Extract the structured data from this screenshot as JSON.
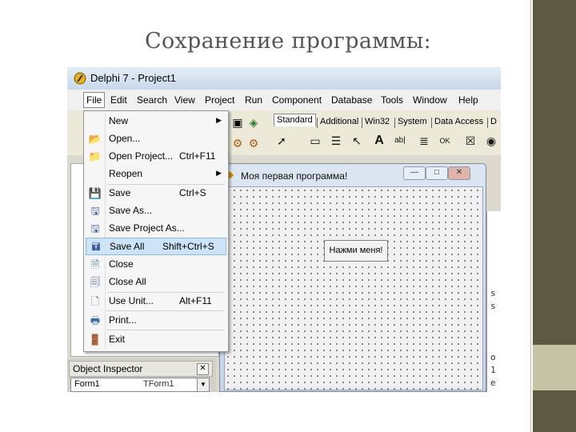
{
  "slide": {
    "title": "Сохранение программы:"
  },
  "colors": {
    "sidebar": "#5c5842",
    "sidebar_accent": "#c5c3a3",
    "menu_highlight": "#cde3f7"
  },
  "ide": {
    "title": "Delphi 7 - Project1",
    "menu": [
      "File",
      "Edit",
      "Search",
      "View",
      "Project",
      "Run",
      "Component",
      "Database",
      "Tools",
      "Window",
      "Help"
    ],
    "palette_tabs": [
      "Standard",
      "Additional",
      "Win32",
      "System",
      "Data Access",
      "D"
    ],
    "palette_icons": [
      "pointer-icon",
      "frame-icon",
      "main-menu-icon",
      "popup-menu-icon",
      "label-icon",
      "edit-icon",
      "memo-icon",
      "button-icon",
      "checkbox-icon",
      "radiobutton-icon"
    ],
    "side_fragments": [
      "s",
      "s",
      "o",
      "1",
      "e"
    ]
  },
  "file_menu": {
    "items": [
      {
        "label": "New",
        "shortcut": "",
        "submenu": true,
        "icon": ""
      },
      {
        "label": "Open...",
        "shortcut": "",
        "submenu": false,
        "icon": "open-folder-icon"
      },
      {
        "label": "Open Project...",
        "shortcut": "Ctrl+F11",
        "submenu": false,
        "icon": "open-project-icon"
      },
      {
        "label": "Reopen",
        "shortcut": "",
        "submenu": true,
        "icon": ""
      },
      {
        "label": "Save",
        "shortcut": "Ctrl+S",
        "submenu": false,
        "icon": "save-icon"
      },
      {
        "label": "Save As...",
        "shortcut": "",
        "submenu": false,
        "icon": "save-as-icon"
      },
      {
        "label": "Save Project As...",
        "shortcut": "",
        "submenu": false,
        "icon": "save-project-icon"
      },
      {
        "label": "Save All",
        "shortcut": "Shift+Ctrl+S",
        "submenu": false,
        "icon": "save-all-icon",
        "highlighted": true
      },
      {
        "label": "Close",
        "shortcut": "",
        "submenu": false,
        "icon": "close-file-icon"
      },
      {
        "label": "Close All",
        "shortcut": "",
        "submenu": false,
        "icon": "close-all-icon"
      },
      {
        "label": "Use Unit...",
        "shortcut": "Alt+F11",
        "submenu": false,
        "icon": "use-unit-icon"
      },
      {
        "label": "Print...",
        "shortcut": "",
        "submenu": false,
        "icon": "print-icon"
      },
      {
        "label": "Exit",
        "shortcut": "",
        "submenu": false,
        "icon": "exit-icon"
      }
    ]
  },
  "object_inspector": {
    "title": "Object Inspector",
    "object": "Form1",
    "type": "TForm1"
  },
  "form": {
    "title": "Моя первая программа!",
    "button_caption": "Нажми меня!"
  }
}
